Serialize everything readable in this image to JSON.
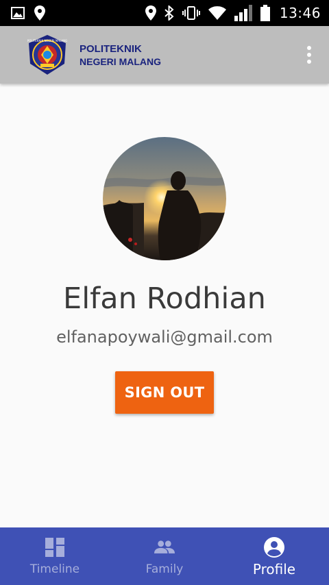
{
  "status_bar": {
    "time": "13:46",
    "icons": [
      "image-icon",
      "location-pin-icon",
      "location-icon",
      "bluetooth-icon",
      "vibrate-icon",
      "wifi-icon",
      "signal-icon",
      "battery-icon"
    ]
  },
  "header": {
    "logo_icon": "institution-logo",
    "title_line1": "POLITEKNIK",
    "title_line2": "NEGERI MALANG",
    "menu_icon": "more-vert-icon",
    "brand_color": "#1a237e",
    "background": "#bdbdbd"
  },
  "profile": {
    "avatar_icon": "profile-photo",
    "name": "Elfan Rodhian",
    "email": "elfanapoywali@gmail.com",
    "sign_out_label": "SIGN OUT",
    "sign_out_color": "#ee6311"
  },
  "bottom_nav": {
    "background": "#3f51b5",
    "items": [
      {
        "label": "Timeline",
        "icon": "dashboard-icon",
        "active": false
      },
      {
        "label": "Family",
        "icon": "group-icon",
        "active": false
      },
      {
        "label": "Profile",
        "icon": "account-circle-icon",
        "active": true
      }
    ]
  }
}
